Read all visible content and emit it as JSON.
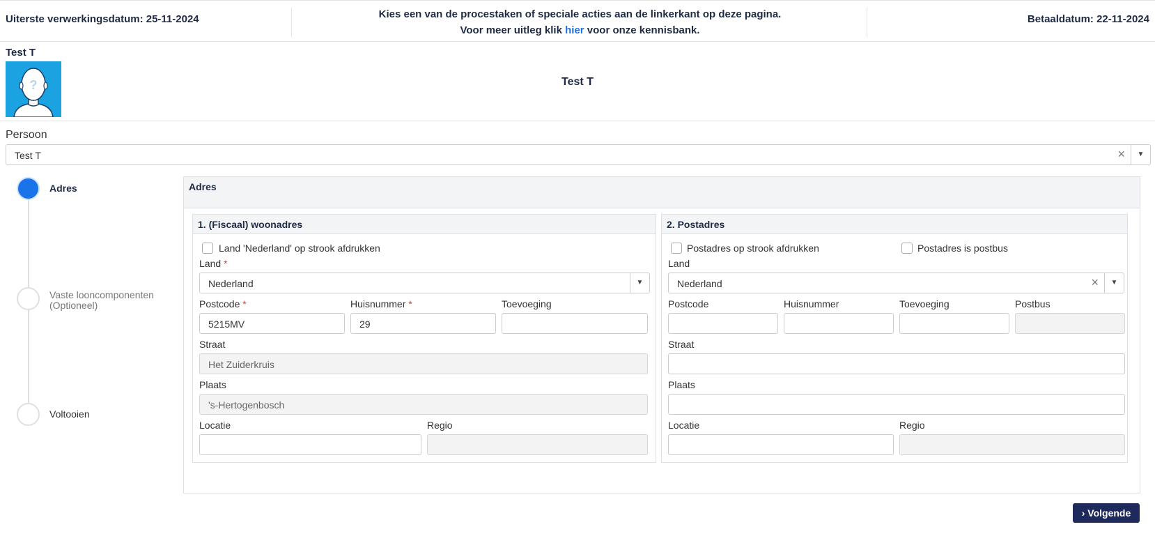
{
  "header": {
    "deadline": "Uiterste verwerkingsdatum: 25-11-2024",
    "instruction_line1": "Kies een van de procestaken of speciale acties aan de linkerkant op deze pagina.",
    "instruction_line2_pre": "Voor meer uitleg klik ",
    "instruction_link": "hier",
    "instruction_line2_post": " voor onze kennisbank.",
    "paydate": "Betaaldatum: 22-11-2024"
  },
  "person": {
    "name_small": "Test T",
    "name_center": "Test T",
    "avatar_icon": "person-placeholder-icon"
  },
  "persoon_field": {
    "label": "Persoon",
    "value": "Test T",
    "clear": "×",
    "arrow": "▼"
  },
  "steps": [
    {
      "label": "Adres",
      "state": "active"
    },
    {
      "label": "Vaste looncomponenten (Optioneel)",
      "state": "inactive"
    },
    {
      "label": "Voltooien",
      "state": "inactive"
    }
  ],
  "panel": {
    "title": "Adres",
    "woonadres": {
      "title": "1. (Fiscaal) woonadres",
      "checkbox_label": "Land 'Nederland' op strook afdrukken",
      "land_label": "Land",
      "land_value": "Nederland",
      "postcode_label": "Postcode",
      "postcode_value": "5215MV",
      "huisnummer_label": "Huisnummer",
      "huisnummer_value": "29",
      "toevoeging_label": "Toevoeging",
      "toevoeging_value": "",
      "straat_label": "Straat",
      "straat_value": "Het Zuiderkruis",
      "plaats_label": "Plaats",
      "plaats_value": "'s-Hertogenbosch",
      "locatie_label": "Locatie",
      "locatie_value": "",
      "regio_label": "Regio",
      "regio_value": "",
      "required_mark": "*"
    },
    "postadres": {
      "title": "2. Postadres",
      "checkbox1_label": "Postadres op strook afdrukken",
      "checkbox2_label": "Postadres is postbus",
      "land_label": "Land",
      "land_value": "Nederland",
      "postcode_label": "Postcode",
      "huisnummer_label": "Huisnummer",
      "toevoeging_label": "Toevoeging",
      "postbus_label": "Postbus",
      "straat_label": "Straat",
      "plaats_label": "Plaats",
      "locatie_label": "Locatie",
      "regio_label": "Regio"
    }
  },
  "actions": {
    "next_label": "Volgende",
    "next_icon": "chevron-right-icon"
  },
  "colors": {
    "accent": "#1a73e8",
    "navy": "#1f2a5c",
    "avatar_bg": "#1aa3e0"
  }
}
